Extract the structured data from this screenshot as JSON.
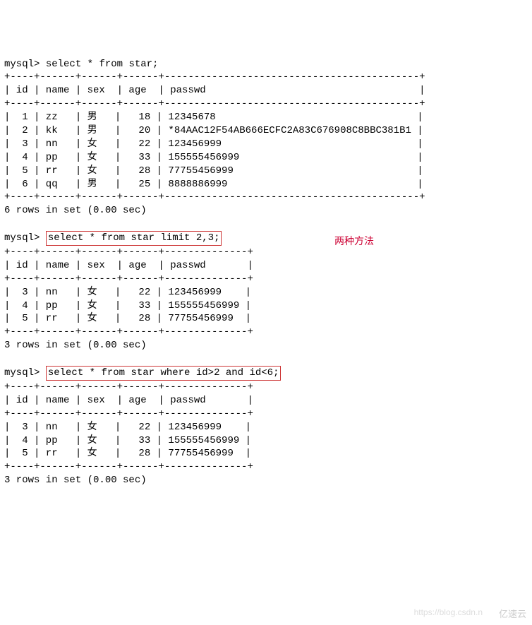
{
  "prompt": "mysql>",
  "queries": {
    "q1": "select * from star;",
    "q2": "select * from star limit 2,3;",
    "q3": "select * from star where id>2 and id<6;"
  },
  "table1": {
    "sep": "+----+------+------+------+-------------------------------------------+",
    "header": "| id | name | sex  | age  | passwd                                    |",
    "rows": [
      "|  1 | zz   | 男   |   18 | 12345678                                  |",
      "|  2 | kk   | 男   |   20 | *84AAC12F54AB666ECFC2A83C676908C8BBC381B1 |",
      "|  3 | nn   | 女   |   22 | 123456999                                 |",
      "|  4 | pp   | 女   |   33 | 155555456999                              |",
      "|  5 | rr   | 女   |   28 | 77755456999                               |",
      "|  6 | qq   | 男   |   25 | 8888886999                                |"
    ],
    "footer": "6 rows in set (0.00 sec)"
  },
  "table2": {
    "sep": "+----+------+------+------+--------------+",
    "header": "| id | name | sex  | age  | passwd       |",
    "rows": [
      "|  3 | nn   | 女   |   22 | 123456999    |",
      "|  4 | pp   | 女   |   33 | 155555456999 |",
      "|  5 | rr   | 女   |   28 | 77755456999  |"
    ],
    "footer": "3 rows in set (0.00 sec)"
  },
  "table3": {
    "sep": "+----+------+------+------+--------------+",
    "header": "| id | name | sex  | age  | passwd       |",
    "rows": [
      "|  3 | nn   | 女   |   22 | 123456999    |",
      "|  4 | pp   | 女   |   33 | 155555456999 |",
      "|  5 | rr   | 女   |   28 | 77755456999  |"
    ],
    "footer": "3 rows in set (0.00 sec)"
  },
  "annotation": "两种方法",
  "watermarks": {
    "w1": "https://blog.csdn.n",
    "w2": "亿速云"
  },
  "chart_data": {
    "type": "table",
    "description": "MySQL query output showing star table contents and two filtering methods (LIMIT and WHERE)",
    "columns": [
      "id",
      "name",
      "sex",
      "age",
      "passwd"
    ],
    "full_rows": [
      {
        "id": 1,
        "name": "zz",
        "sex": "男",
        "age": 18,
        "passwd": "12345678"
      },
      {
        "id": 2,
        "name": "kk",
        "sex": "男",
        "age": 20,
        "passwd": "*84AAC12F54AB666ECFC2A83C676908C8BBC381B1"
      },
      {
        "id": 3,
        "name": "nn",
        "sex": "女",
        "age": 22,
        "passwd": "123456999"
      },
      {
        "id": 4,
        "name": "pp",
        "sex": "女",
        "age": 33,
        "passwd": "155555456999"
      },
      {
        "id": 5,
        "name": "rr",
        "sex": "女",
        "age": 28,
        "passwd": "77755456999"
      },
      {
        "id": 6,
        "name": "qq",
        "sex": "男",
        "age": 25,
        "passwd": "8888886999"
      }
    ],
    "filtered_rows": [
      {
        "id": 3,
        "name": "nn",
        "sex": "女",
        "age": 22,
        "passwd": "123456999"
      },
      {
        "id": 4,
        "name": "pp",
        "sex": "女",
        "age": 33,
        "passwd": "155555456999"
      },
      {
        "id": 5,
        "name": "rr",
        "sex": "女",
        "age": 28,
        "passwd": "77755456999"
      }
    ]
  }
}
